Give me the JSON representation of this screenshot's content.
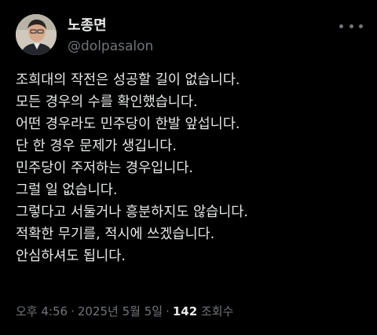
{
  "author": {
    "display_name": "노종면",
    "handle": "@dolpasalon",
    "avatar_icon": "person-photo-avatar"
  },
  "more_icon": "more-horizontal-icon",
  "tweet": {
    "lines": [
      "조희대의 작전은 성공할 길이 없습니다.",
      "모든 경우의 수를 확인했습니다.",
      "어떤 경우라도 민주당이 한발 앞섭니다.",
      "단 한 경우 문제가 생깁니다.",
      "민주당이 주저하는 경우입니다.",
      "그럴 일 없습니다.",
      "그렇다고 서둘거나 흥분하지도 않습니다.",
      "적확한 무기를, 적시에 쓰겠습니다.",
      "안심하셔도 됩니다."
    ]
  },
  "meta": {
    "time": "오후 4:56",
    "separator": "·",
    "date": "2025년 5월 5일",
    "views_count": "142",
    "views_label": "조회수"
  },
  "colors": {
    "background": "#000000",
    "primary_text": "#e7e9ea",
    "secondary_text": "#71767b"
  }
}
